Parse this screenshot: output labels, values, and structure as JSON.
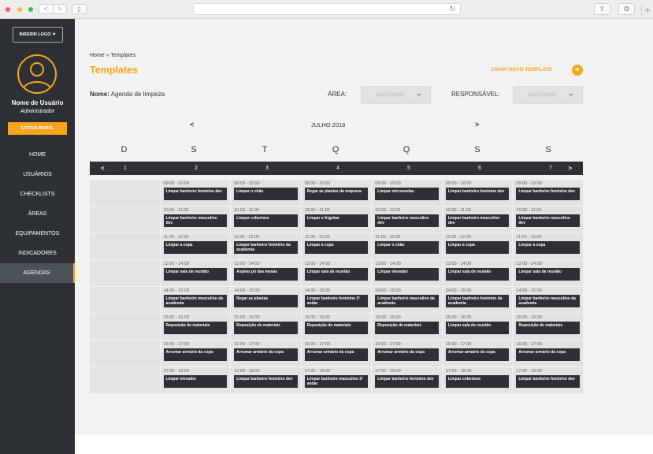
{
  "browser": {
    "nav_back": "<",
    "nav_forward": ">",
    "reload_icon": "↻",
    "new_tab": "+"
  },
  "sidebar": {
    "logo_button": "INSERIR LOGO ▼",
    "user_name": "Nome de Usuário",
    "user_role": "Administrador",
    "edit_profile": "EDITAR PERFIL",
    "menu": [
      {
        "label": "HOME",
        "active": false
      },
      {
        "label": "USUÁRIOS",
        "active": false
      },
      {
        "label": "CHECKLISTS",
        "active": false
      },
      {
        "label": "ÁREAS",
        "active": false
      },
      {
        "label": "EQUIPAMENTOS",
        "active": false
      },
      {
        "label": "INDICADORES",
        "active": false
      },
      {
        "label": "AGENDAS",
        "active": true
      }
    ],
    "accent_color": "#f7a51d"
  },
  "header": {
    "breadcrumb": "Home » Templates",
    "title": "Templates",
    "new_template": "CRIAR NOVO TEMPLATE",
    "new_template_icon": "+"
  },
  "filters": {
    "name_label": "Nome:",
    "name_value": "Agenda de limpeza",
    "area_label": "ÁREA:",
    "area_placeholder": "SELECIONE",
    "resp_label": "RESPONSÁVEL:",
    "resp_placeholder": "SELECIONE"
  },
  "calendar": {
    "prev": "<",
    "next": ">",
    "month": "JULHO 2018",
    "day_letters": [
      "D",
      "S",
      "T",
      "Q",
      "Q",
      "S",
      "S"
    ],
    "dates": [
      "1",
      "2",
      "3",
      "4",
      "5",
      "6",
      "7"
    ],
    "bar_prev": "<",
    "bar_next": ">",
    "rows": [
      {
        "time": "09:00 - 10:00",
        "tasks": [
          "Limpar banheiro feminino dev",
          "Limpar o chão",
          "Regar as plantas da empresa",
          "Limpar microondas",
          "Limpar banheiro feminino dev",
          "Limpar banheiro feminino dev"
        ]
      },
      {
        "time": "10:00 - 11:00",
        "tasks": [
          "Limpar banheiro masculino dev",
          "Limpar cobertura",
          "Limpar o frigobar",
          "Limpar banheiro masculino dev",
          "Limpar banheiro masculino dev",
          "Limpar banheiro masculino dev"
        ]
      },
      {
        "time": "11:00 - 12:00",
        "tasks": [
          "Limpar a copa",
          "Limpar banheiro feminino da academia",
          "Limpar a copa",
          "Limpar o chão",
          "Limpar a copa",
          "Limpar a copa"
        ]
      },
      {
        "time": "13:00 - 14:00",
        "tasks": [
          "Limpar sala de reunião",
          "Aspirar pó das mesas",
          "Limpar sala de reunião",
          "Limpar elevador",
          "Limpar sala de reunião",
          "Limpar sala de reunião"
        ]
      },
      {
        "time": "14:00 - 15:00",
        "tasks": [
          "Limpar banheiro masculino da academia",
          "Regar as plantas",
          "Limpar banheiro feminino 2º andar",
          "Limpar banheiro masculino da academia",
          "Limpar banheiro feminino da academia",
          "Limpar banheiro masculino da academia"
        ]
      },
      {
        "time": "15:00 - 16:00",
        "tasks": [
          "Reposição de materiais",
          "Reposição de materiais",
          "Reposição de materiais",
          "Reposição de materiais",
          "Limpar sala de reunião",
          "Reposição de materiais"
        ]
      },
      {
        "time": "16:00 - 17:00",
        "tasks": [
          "Arrumar armário da copa",
          "Arrumar armário da copa",
          "Arrumar armário da copa",
          "Arrumar armário da copa",
          "Arrumar armário da copa",
          "Arrumar armário da copa"
        ]
      },
      {
        "time": "17:00 - 18:00",
        "tasks": [
          "Limpar elevador",
          "Limpar banheiro feminino dev",
          "Limpar banheiro masculino 2º andar",
          "Limpar banheiro feminino dev",
          "Limpar cobertura",
          "Limpar banheiro feminino dev"
        ]
      }
    ]
  }
}
